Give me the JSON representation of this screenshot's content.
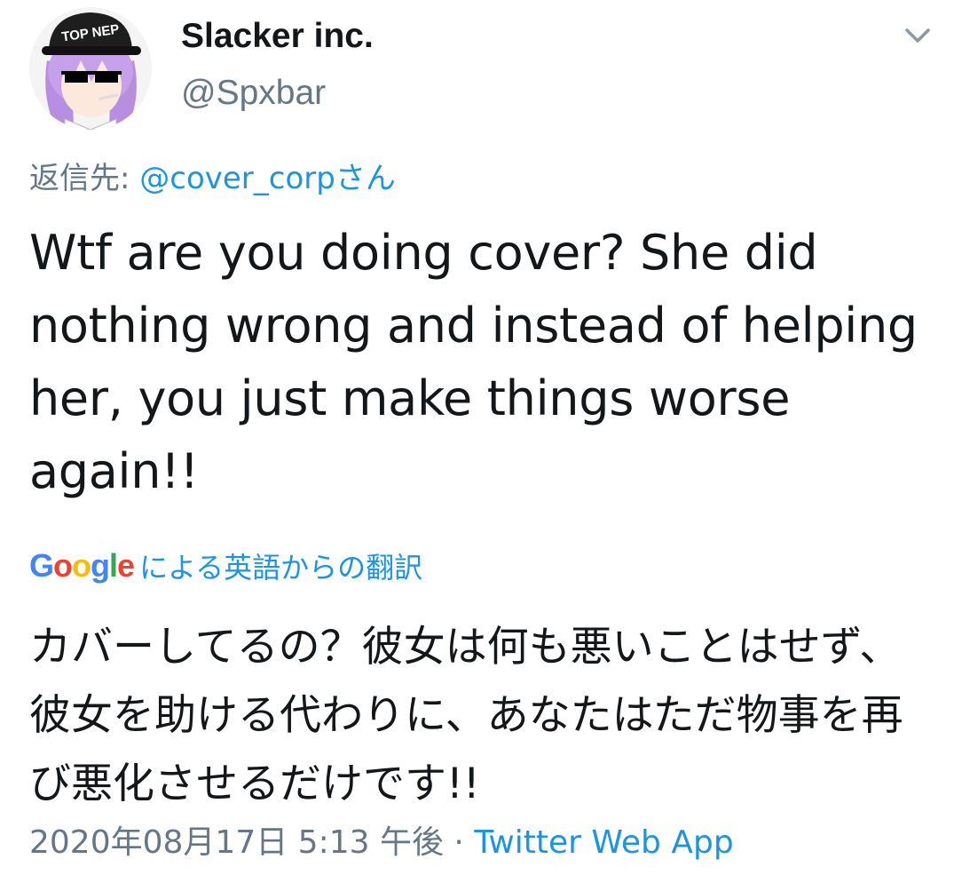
{
  "user": {
    "display_name": "Slacker inc.",
    "handle": "@Spxbar",
    "avatar_cap_text": "TOP NEP"
  },
  "reply": {
    "prefix": "返信先: ",
    "mention": "@cover_corpさん"
  },
  "tweet": {
    "text": "Wtf are you doing cover? She did nothing wrong and instead of helping her, you just make things worse again!!"
  },
  "translation": {
    "google_logo": [
      "G",
      "o",
      "o",
      "g",
      "l",
      "e"
    ],
    "label": "による英語からの翻訳",
    "text": "カバーしてるの？彼女は何も悪いことはせず、彼女を助ける代わりに、あなたはただ物事を再び悪化させるだけです!!"
  },
  "meta": {
    "timestamp": "2020年08月17日 5:13 午後",
    "separator": " · ",
    "source": "Twitter Web App"
  },
  "colors": {
    "text": "#14171a",
    "secondary": "#657786",
    "link": "#1b95e0",
    "google_blue": "#4285f4",
    "google_red": "#ea4335",
    "google_yellow": "#fbbc05",
    "google_green": "#34a853"
  },
  "icons": {
    "more_caret": "chevron-down-icon"
  }
}
